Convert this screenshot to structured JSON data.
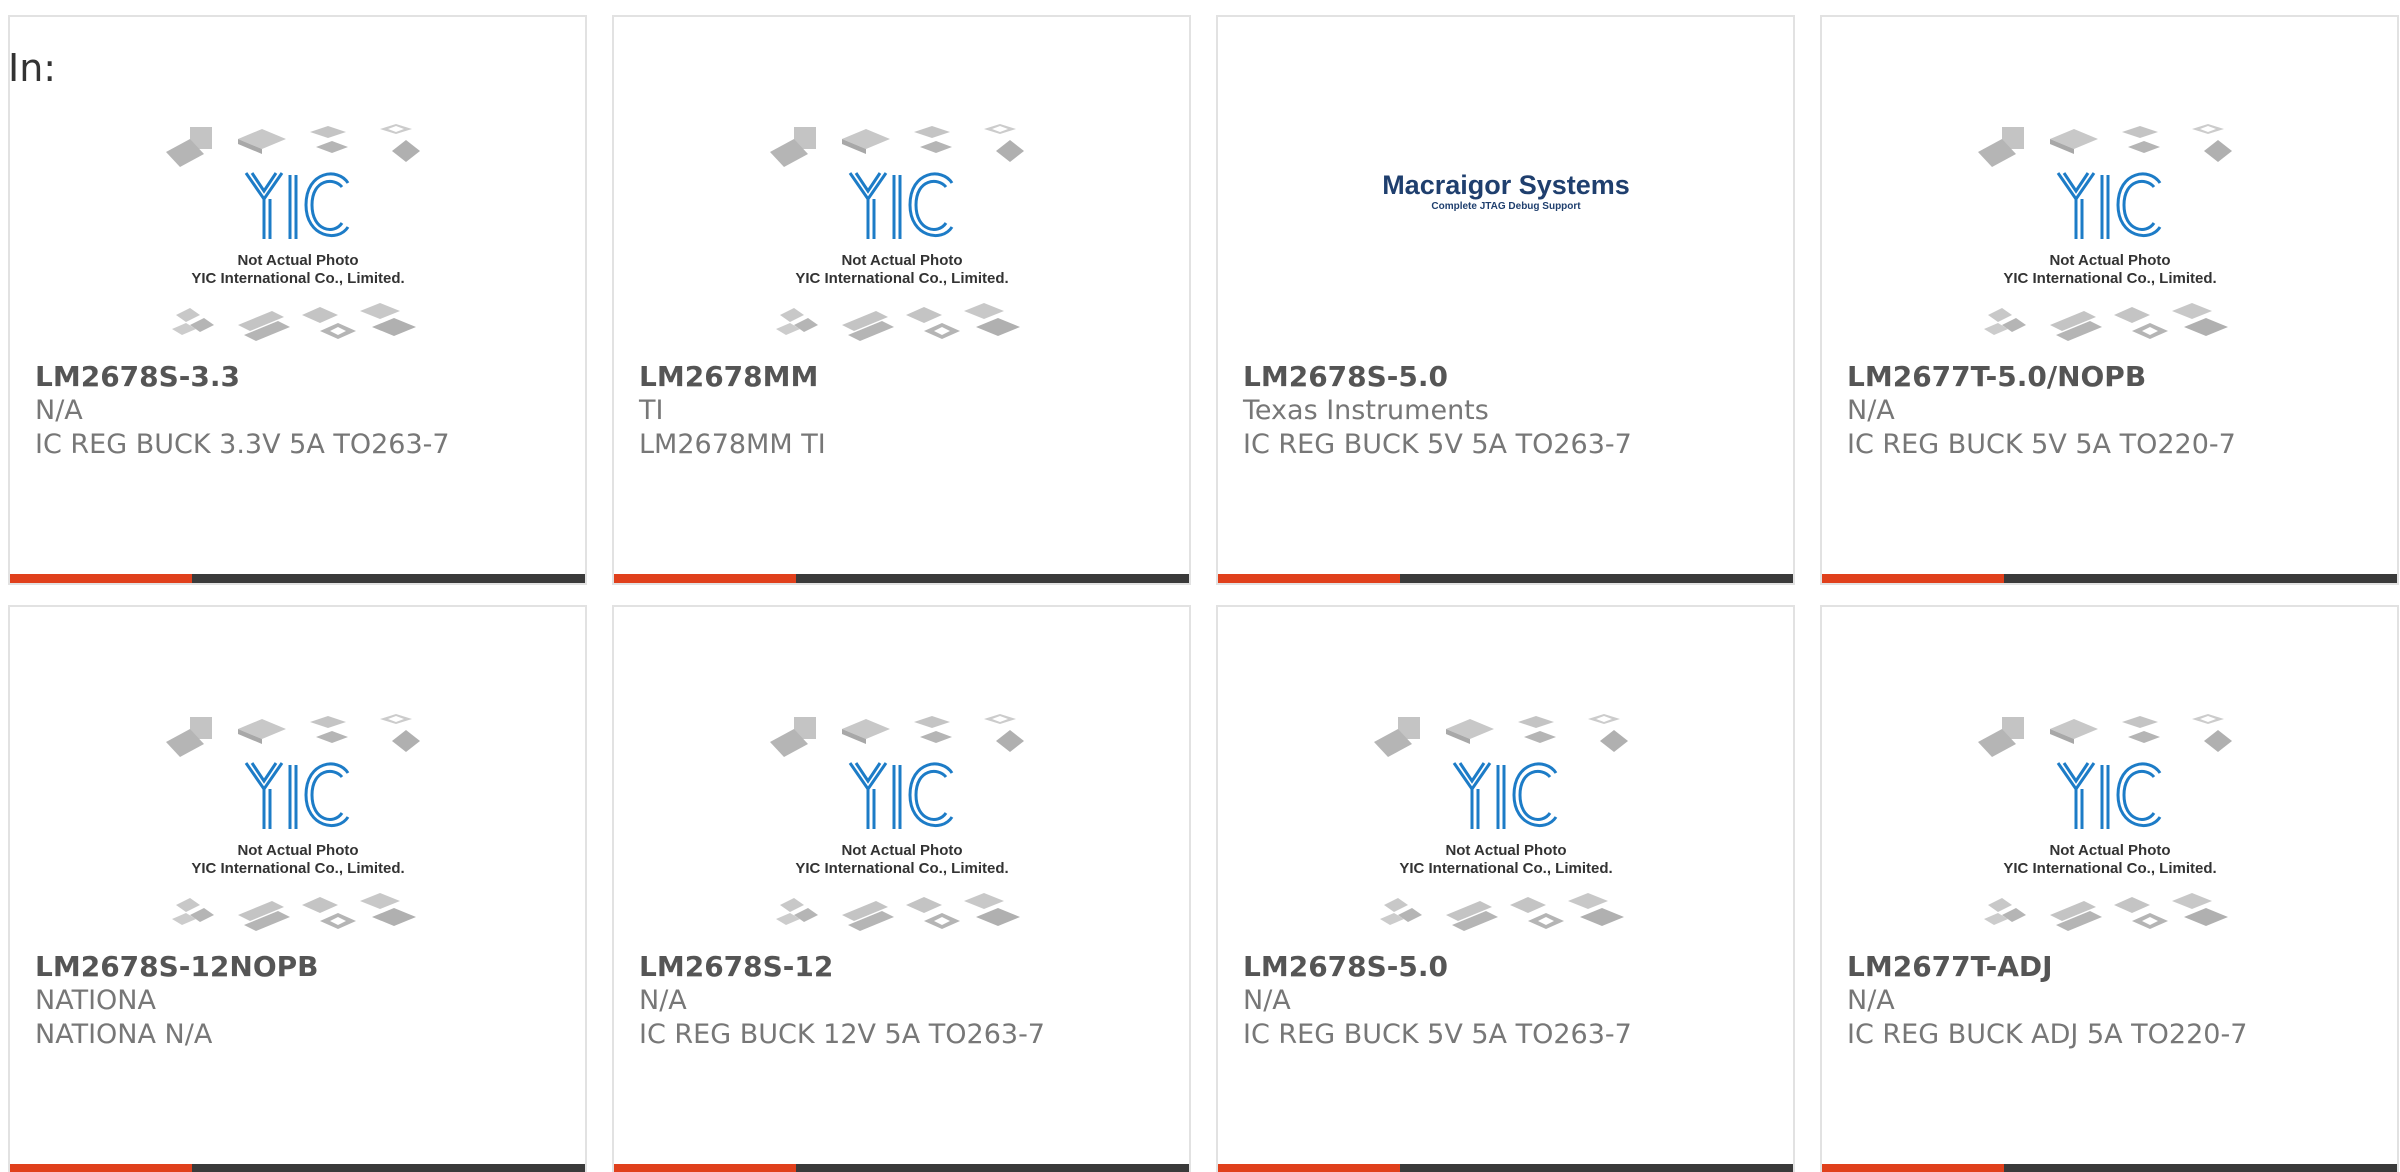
{
  "header": {
    "in_label": "In:"
  },
  "placeholder": {
    "line1": "Not Actual Photo",
    "line2": "YIC International Co., Limited."
  },
  "macraigor": {
    "line1": "Macraigor Systems",
    "line2": "Complete JTAG Debug Support"
  },
  "colors": {
    "accent": "#e0401c",
    "bar": "#3a3a3a",
    "border": "#e2e2e2",
    "logo_blue": "#1d7cc7",
    "macraigor_blue": "#1f3f6e"
  },
  "products": [
    {
      "part": "LM2678S-3.3",
      "manufacturer": "N/A",
      "description": "IC REG BUCK 3.3V 5A TO263-7",
      "image": "yic-placeholder"
    },
    {
      "part": "LM2678MM",
      "manufacturer": "TI",
      "description": "LM2678MM TI",
      "image": "yic-placeholder"
    },
    {
      "part": "LM2678S-5.0",
      "manufacturer": "Texas Instruments",
      "description": "IC REG BUCK 5V 5A TO263-7",
      "image": "macraigor-logo"
    },
    {
      "part": "LM2677T-5.0/NOPB",
      "manufacturer": "N/A",
      "description": "IC REG BUCK 5V 5A TO220-7",
      "image": "yic-placeholder"
    },
    {
      "part": "LM2678S-12NOPB",
      "manufacturer": "NATIONA",
      "description": "NATIONA N/A",
      "image": "yic-placeholder"
    },
    {
      "part": "LM2678S-12",
      "manufacturer": "N/A",
      "description": "IC REG BUCK 12V 5A TO263-7",
      "image": "yic-placeholder"
    },
    {
      "part": "LM2678S-5.0",
      "manufacturer": "N/A",
      "description": "IC REG BUCK 5V 5A TO263-7",
      "image": "yic-placeholder"
    },
    {
      "part": "LM2677T-ADJ",
      "manufacturer": "N/A",
      "description": "IC REG BUCK ADJ 5A TO220-7",
      "image": "yic-placeholder"
    }
  ]
}
